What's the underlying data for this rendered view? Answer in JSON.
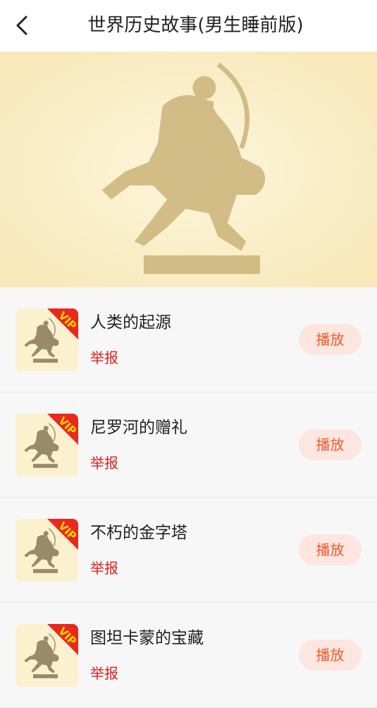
{
  "header": {
    "title": "世界历史故事(男生睡前版)"
  },
  "banner": {
    "image": "horseman-archer-statue"
  },
  "items": [
    {
      "title": "人类的起源",
      "report_label": "举报",
      "play_label": "播放",
      "badge": "VIP"
    },
    {
      "title": "尼罗河的赠礼",
      "report_label": "举报",
      "play_label": "播放",
      "badge": "VIP"
    },
    {
      "title": "不朽的金字塔",
      "report_label": "举报",
      "play_label": "播放",
      "badge": "VIP"
    },
    {
      "title": "图坦卡蒙的宝藏",
      "report_label": "举报",
      "play_label": "播放",
      "badge": "VIP"
    }
  ],
  "colors": {
    "report": "#e02020",
    "play_text": "#ef5a2c",
    "play_bg": "#fde6e0",
    "vip_ribbon": "#e8291c"
  }
}
